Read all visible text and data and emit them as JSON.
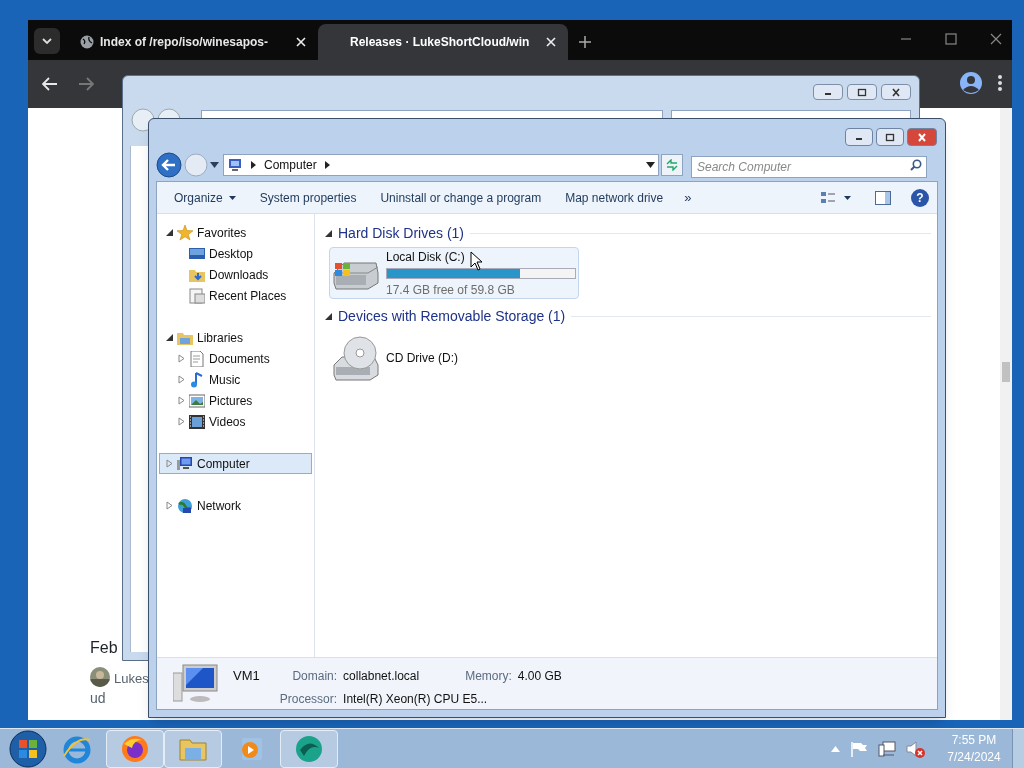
{
  "browser": {
    "tabs": [
      {
        "label": "Index of /repo/iso/winesapos-",
        "selected": false
      },
      {
        "label": "Releases · LukeShortCloud/win",
        "selected": true
      }
    ],
    "page_texts": [
      "Feb",
      "Lukes",
      "ud"
    ]
  },
  "explorer": {
    "address": [
      "Computer"
    ],
    "search": {
      "placeholder": "Search Computer"
    },
    "toolbar": [
      {
        "label": "Organize",
        "dropdown": true
      },
      {
        "label": "System properties",
        "dropdown": false
      },
      {
        "label": "Uninstall or change a program",
        "dropdown": false
      },
      {
        "label": "Map network drive",
        "dropdown": false
      }
    ],
    "toolbar_more": "»",
    "help": "?",
    "nav": [
      {
        "kind": "favorites",
        "label": "Favorites",
        "expanded": true,
        "selected": false,
        "children": [
          {
            "kind": "desktop",
            "label": "Desktop",
            "selected": false
          },
          {
            "kind": "downloads",
            "label": "Downloads",
            "selected": false
          },
          {
            "kind": "recent",
            "label": "Recent Places",
            "selected": false
          }
        ]
      },
      {
        "kind": "libraries",
        "label": "Libraries",
        "expanded": true,
        "selected": false,
        "children": [
          {
            "kind": "documents",
            "label": "Documents",
            "selected": false
          },
          {
            "kind": "music",
            "label": "Music",
            "selected": false
          },
          {
            "kind": "pictures",
            "label": "Pictures",
            "selected": false
          },
          {
            "kind": "videos",
            "label": "Videos",
            "selected": false
          }
        ]
      },
      {
        "kind": "computer",
        "label": "Computer",
        "expanded": false,
        "selected": true
      },
      {
        "kind": "network",
        "label": "Network",
        "expanded": false,
        "selected": false
      }
    ],
    "groups": [
      {
        "title": "Hard Disk Drives (1)",
        "items": [
          {
            "kind": "disk",
            "name": "Local Disk (C:)",
            "level": 0.71,
            "free": "17.4 GB free of 59.8 GB",
            "highlighted": true
          }
        ]
      },
      {
        "title": "Devices with Removable Storage (1)",
        "items": [
          {
            "kind": "cd",
            "name": "CD Drive (D:)",
            "highlighted": false
          }
        ]
      }
    ],
    "details": {
      "name": "VM1",
      "fields": [
        {
          "label": "Domain:",
          "value": "collabnet.local"
        },
        {
          "label": "Memory:",
          "value": "4.00 GB"
        },
        {
          "label": "Processor:",
          "value": "Intel(R) Xeon(R) CPU E5..."
        }
      ]
    }
  },
  "taskbar": {
    "time": "7:55 PM",
    "date": "7/24/2024"
  }
}
